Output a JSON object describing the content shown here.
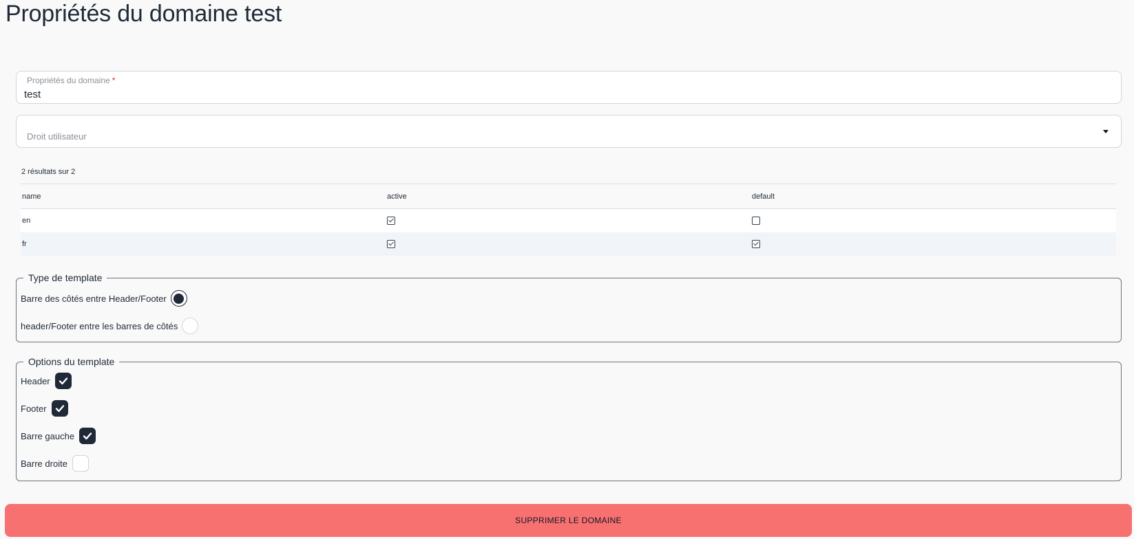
{
  "page": {
    "title": "Propriétés du domaine test"
  },
  "domain_field": {
    "label": "Propriétés du domaine",
    "required_mark": "*",
    "value": "test"
  },
  "rights_select": {
    "placeholder": "Droit utilisateur"
  },
  "table": {
    "result_count": "2 résultats sur 2",
    "columns": [
      "name",
      "active",
      "default"
    ],
    "rows": [
      {
        "name": "en",
        "active": true,
        "default": false
      },
      {
        "name": "fr",
        "active": true,
        "default": true
      }
    ]
  },
  "template_type": {
    "legend": "Type de template",
    "options": [
      {
        "label": "Barre des côtés entre Header/Footer",
        "selected": true
      },
      {
        "label": "header/Footer entre les barres de côtés",
        "selected": false
      }
    ]
  },
  "template_options": {
    "legend": "Options du template",
    "options": [
      {
        "label": "Header",
        "checked": true
      },
      {
        "label": "Footer",
        "checked": true
      },
      {
        "label": "Barre gauche",
        "checked": true
      },
      {
        "label": "Barre droite",
        "checked": false
      }
    ]
  },
  "delete_button": {
    "label": "SUPPRIMER LE DOMAINE"
  },
  "colors": {
    "danger": "#f87171",
    "dark": "#1f2937",
    "stripe": "#f1f4f8"
  }
}
